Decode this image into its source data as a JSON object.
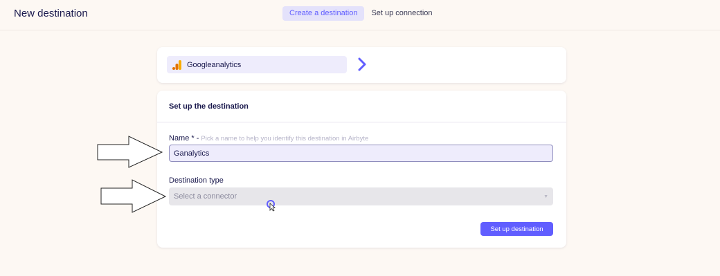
{
  "header": {
    "title": "New destination",
    "steps": [
      {
        "label": "Create a destination",
        "active": true
      },
      {
        "label": "Set up connection",
        "active": false
      }
    ]
  },
  "source": {
    "name": "Googleanalytics",
    "icon": "google-analytics-icon"
  },
  "destination_form": {
    "title": "Set up the destination",
    "name_label": "Name * -",
    "name_hint": "Pick a name to help you identify this destination in Airbyte",
    "name_value": "Ganalytics",
    "type_label": "Destination type",
    "type_placeholder": "Select a connector",
    "submit_label": "Set up destination"
  },
  "colors": {
    "accent": "#615eff",
    "background": "#fdf8f3",
    "text": "#1a194d"
  }
}
